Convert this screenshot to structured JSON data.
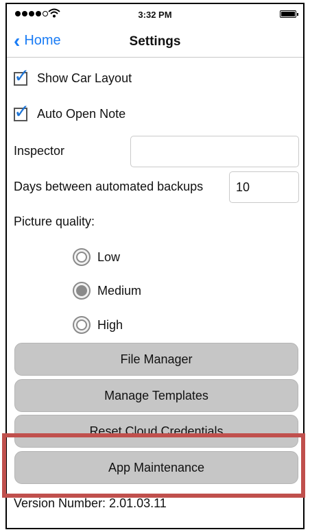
{
  "status_bar": {
    "time": "3:32 PM",
    "signal_dots_filled": 4,
    "signal_dots_total": 5
  },
  "nav": {
    "back_label": "Home",
    "title": "Settings"
  },
  "settings": {
    "show_car_layout": {
      "label": "Show Car Layout",
      "checked": true
    },
    "auto_open_note": {
      "label": "Auto Open Note",
      "checked": true
    },
    "inspector": {
      "label": "Inspector",
      "value": ""
    },
    "backup_days": {
      "label": "Days between automated backups",
      "value": "10"
    },
    "picture_quality": {
      "label": "Picture quality:",
      "options": [
        "Low",
        "Medium",
        "High"
      ],
      "selected": "Medium"
    }
  },
  "buttons": {
    "file_manager": "File Manager",
    "manage_templates": "Manage Templates",
    "reset_cloud": "Reset Cloud Credentials",
    "app_maintenance": "App Maintenance"
  },
  "version": "Version Number: 2.01.03.11",
  "colors": {
    "accent": "#1a7cf5",
    "highlight": "#c0504d",
    "button_bg": "#c6c6c6"
  }
}
